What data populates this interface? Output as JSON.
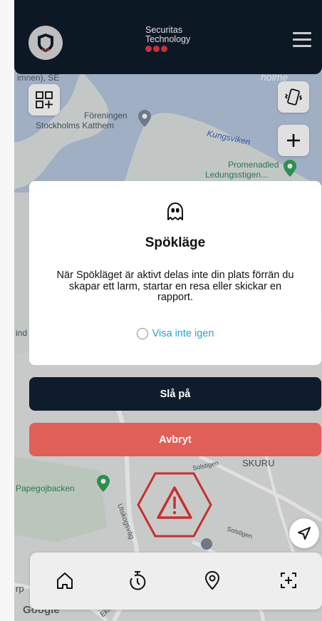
{
  "header": {
    "brand_line1": "Securitas",
    "brand_line2": "Technology"
  },
  "map": {
    "labels": {
      "topleft": "imnen), SE",
      "holme": "holme",
      "foreningen": "Föreningen",
      "stockholms": "Stockholms Katthem",
      "kungsviken": "Kungsviken",
      "promenadled": "Promenadled",
      "ledungsstigen": "Ledungsstigen...",
      "ind": "ind",
      "skuru": "SKURU",
      "solstigen1": "Solstigen",
      "solstigen2": "Solstigen",
      "papegojbacken": "Papegojbacken",
      "utskogsvag": "Utskogsväg",
      "rp": "rp",
      "ekto": "Ekto",
      "google": "Google"
    }
  },
  "modal": {
    "icon": "ghost-icon",
    "title": "Spökläge",
    "message": "När Spökläget är aktivt delas inte din plats förrän du skapar ett larm, startar en resa eller skickar en rapport.",
    "checkbox_label": "Visa inte igen",
    "checkbox_checked": false
  },
  "actions": {
    "turn_on": "Slå på",
    "cancel": "Avbryt"
  },
  "colors": {
    "navy": "#0f1c2b",
    "red": "#e05f57",
    "link": "#29a3cc",
    "alarm": "#c7302d"
  },
  "tabbar": {
    "items": [
      "home-icon",
      "timer-icon",
      "location-pin-icon",
      "add-report-icon"
    ]
  }
}
